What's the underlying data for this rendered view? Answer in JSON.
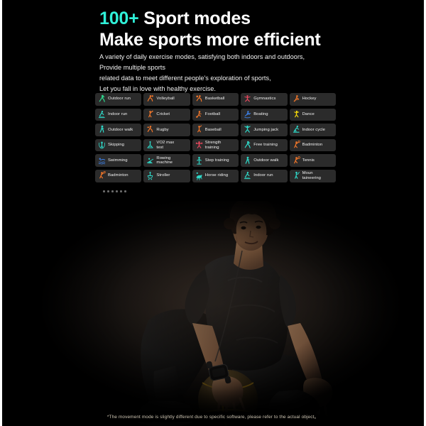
{
  "headline": {
    "number": "100+",
    "line1_rest": " Sport modes",
    "line2": "Make sports more efficient",
    "accent_color": "#2ff0d8"
  },
  "paragraph": {
    "l1": "A variety of daily exercise modes, satisfying both indoors and outdoors,",
    "l2": "Provide multiple sports",
    "l3": "related data to meet different people's exploration of sports,",
    "l4": "Let you fall in love with healthy exercise."
  },
  "tiles": [
    {
      "label": "Outdoor run",
      "icon": "runner-icon",
      "color": "#2fd98f"
    },
    {
      "label": "Volleyball",
      "icon": "volleyball-icon",
      "color": "#f0762a"
    },
    {
      "label": "Basketball",
      "icon": "basketball-icon",
      "color": "#f0762a"
    },
    {
      "label": "Gymnastics",
      "icon": "gymnastics-icon",
      "color": "#e8485e"
    },
    {
      "label": "Hockey",
      "icon": "hockey-icon",
      "color": "#f0762a"
    },
    {
      "label": "Indoor run",
      "icon": "treadmill-icon",
      "color": "#2fd8c8"
    },
    {
      "label": "Cricket",
      "icon": "cricket-icon",
      "color": "#f0762a"
    },
    {
      "label": "Football",
      "icon": "football-icon",
      "color": "#f0762a"
    },
    {
      "label": "Boating",
      "icon": "boating-icon",
      "color": "#3b7de0"
    },
    {
      "label": "Dance",
      "icon": "dance-icon",
      "color": "#f5d90a"
    },
    {
      "label": "Outdoor walk",
      "icon": "walker-icon",
      "color": "#2fd8c8"
    },
    {
      "label": "Rugby",
      "icon": "rugby-icon",
      "color": "#f0762a"
    },
    {
      "label": "Baseball",
      "icon": "baseball-icon",
      "color": "#f0762a"
    },
    {
      "label": "Jumping jack",
      "icon": "jumping-jack-icon",
      "color": "#2fd8c8"
    },
    {
      "label": "Indoor cycle",
      "icon": "indoor-cycle-icon",
      "color": "#2fd8c8"
    },
    {
      "label": "Skipping",
      "icon": "skipping-icon",
      "color": "#2fd8c8"
    },
    {
      "label": "VO2 max\ntest",
      "icon": "vo2-max-icon",
      "color": "#2fd8c8"
    },
    {
      "label": "Strength\ntraining",
      "icon": "strength-icon",
      "color": "#e8485e"
    },
    {
      "label": "Free training",
      "icon": "free-training-icon",
      "color": "#2fd8c8"
    },
    {
      "label": "Badminton",
      "icon": "badminton-icon",
      "color": "#f0762a"
    },
    {
      "label": "Swimming",
      "icon": "swimming-icon",
      "color": "#3b7de0"
    },
    {
      "label": "Rowing\nmachine",
      "icon": "rowing-icon",
      "color": "#2fd8c8"
    },
    {
      "label": "Step training",
      "icon": "step-training-icon",
      "color": "#2fd8c8"
    },
    {
      "label": "Outdoor walk",
      "icon": "walker-icon",
      "color": "#2fd8c8"
    },
    {
      "label": "Tennis",
      "icon": "tennis-icon",
      "color": "#f0762a"
    },
    {
      "label": "Badminton",
      "icon": "badminton-icon",
      "color": "#f0762a"
    },
    {
      "label": "Stroller",
      "icon": "stroller-icon",
      "color": "#2fd8c8"
    },
    {
      "label": "Horse riding",
      "icon": "horse-riding-icon",
      "color": "#2fd8c8"
    },
    {
      "label": "Indoor run",
      "icon": "treadmill-icon",
      "color": "#2fd8c8"
    },
    {
      "label": "Moun\ntaineering",
      "icon": "mountaineering-icon",
      "color": "#2fd8c8"
    }
  ],
  "pagination": {
    "dots": 6
  },
  "hero": {
    "alt": "Man in black sportswear crouching with a basketball and a smartwatch"
  },
  "footer": {
    "disclaimer": "*The movement mode is slightly different due to specific software, please refer to the actual object。"
  }
}
